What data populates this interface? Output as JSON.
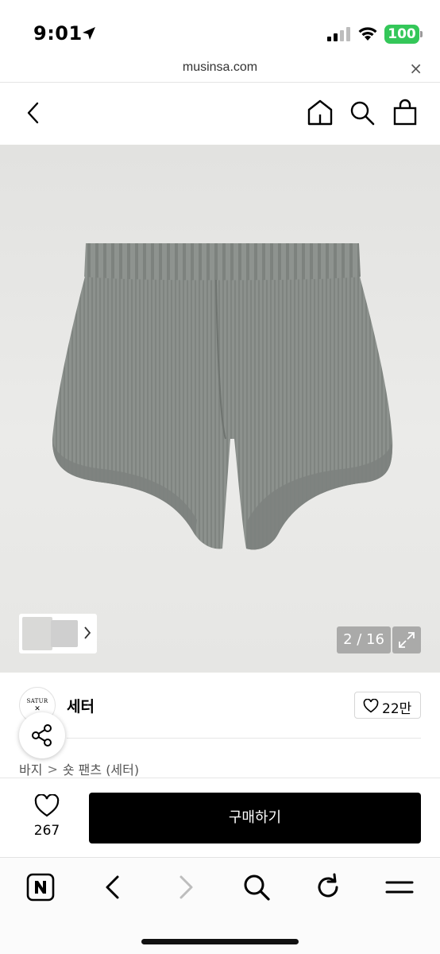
{
  "status_bar": {
    "time": "9:01",
    "battery": "100",
    "icons": [
      "location-arrow-icon",
      "signal-icon",
      "wifi-icon",
      "battery-icon"
    ],
    "battery_color": "#34c759"
  },
  "url_bar": {
    "domain": "musinsa.com",
    "close_label": "×"
  },
  "header": {
    "icons": [
      "back-chevron-icon",
      "home-icon",
      "search-icon",
      "bag-icon"
    ]
  },
  "gallery": {
    "counter": "2 / 16",
    "icons": [
      "thumbnail-chevron-icon",
      "expand-icon"
    ]
  },
  "brand": {
    "logo_text": "SATUR",
    "logo_mark": "✕",
    "name": "세터",
    "like_count": "22만"
  },
  "breadcrumb": {
    "items": [
      "바지",
      "숏 팬츠 (세터)"
    ],
    "separator": ">"
  },
  "purchase": {
    "wish_count": "267",
    "buy_label": "구매하기",
    "buy_color": "#000000"
  },
  "toolbar": {
    "icons": [
      "naver-n-icon",
      "back-icon",
      "forward-icon",
      "search-icon",
      "reload-icon",
      "menu-icon"
    ]
  }
}
